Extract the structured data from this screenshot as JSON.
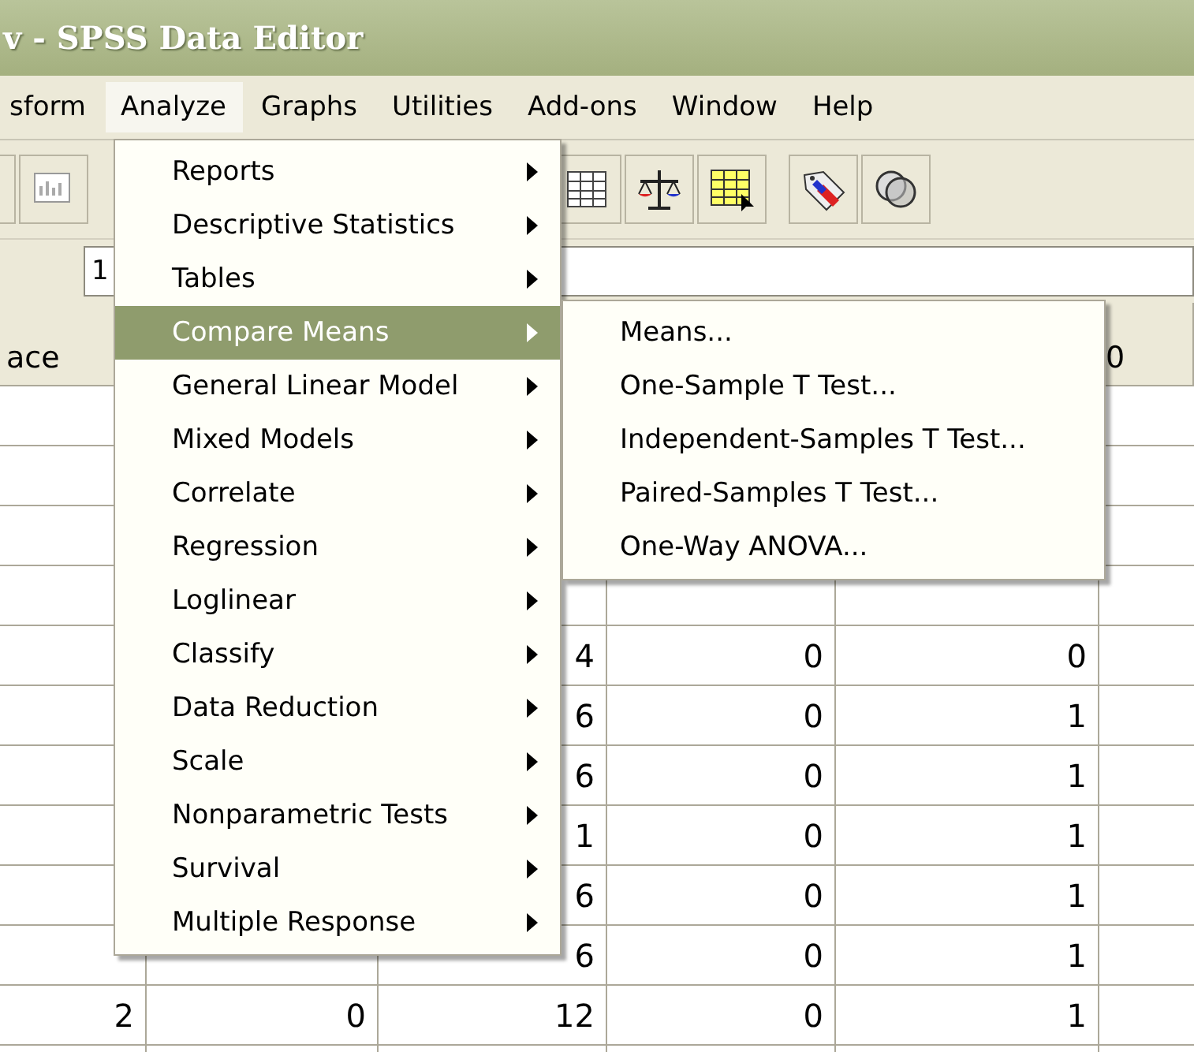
{
  "window": {
    "title": "v - SPSS Data Editor"
  },
  "menubar": [
    {
      "label": "sform",
      "selected": false
    },
    {
      "label": "Analyze",
      "selected": true
    },
    {
      "label": "Graphs",
      "selected": false
    },
    {
      "label": "Utilities",
      "selected": false
    },
    {
      "label": "Add-ons",
      "selected": false
    },
    {
      "label": "Window",
      "selected": false
    },
    {
      "label": "Help",
      "selected": false
    }
  ],
  "cell_editor": {
    "value": "1"
  },
  "grid": {
    "column_headers": {
      "column_1": "ace",
      "column_6": "0"
    },
    "rows": [
      {},
      {},
      {},
      {},
      {
        "column_3": "4",
        "column_4": "0",
        "column_5": "0"
      },
      {
        "column_3": "6",
        "column_4": "0",
        "column_5": "1"
      },
      {
        "column_3": "6",
        "column_4": "0",
        "column_5": "1"
      },
      {
        "column_3": "1",
        "column_4": "0",
        "column_5": "1"
      },
      {
        "column_3": "6",
        "column_4": "0",
        "column_5": "1"
      },
      {
        "column_3": "6",
        "column_4": "0",
        "column_5": "1"
      },
      {
        "column_1": "2",
        "column_2": "0",
        "column_3": "12",
        "column_4": "0",
        "column_5": "1"
      },
      {}
    ]
  },
  "analyze_menu": {
    "items": [
      {
        "label": "Reports",
        "selected": false
      },
      {
        "label": "Descriptive Statistics",
        "selected": false
      },
      {
        "label": "Tables",
        "selected": false
      },
      {
        "label": "Compare Means",
        "selected": true
      },
      {
        "label": "General Linear Model",
        "selected": false
      },
      {
        "label": "Mixed Models",
        "selected": false
      },
      {
        "label": "Correlate",
        "selected": false
      },
      {
        "label": "Regression",
        "selected": false
      },
      {
        "label": "Loglinear",
        "selected": false
      },
      {
        "label": "Classify",
        "selected": false
      },
      {
        "label": "Data Reduction",
        "selected": false
      },
      {
        "label": "Scale",
        "selected": false
      },
      {
        "label": "Nonparametric Tests",
        "selected": false
      },
      {
        "label": "Survival",
        "selected": false
      },
      {
        "label": "Multiple Response",
        "selected": false
      }
    ]
  },
  "compare_means_menu": {
    "items": [
      "Means...",
      "One-Sample T Test...",
      "Independent-Samples T Test...",
      "Paired-Samples T Test...",
      "One-Way ANOVA..."
    ]
  }
}
